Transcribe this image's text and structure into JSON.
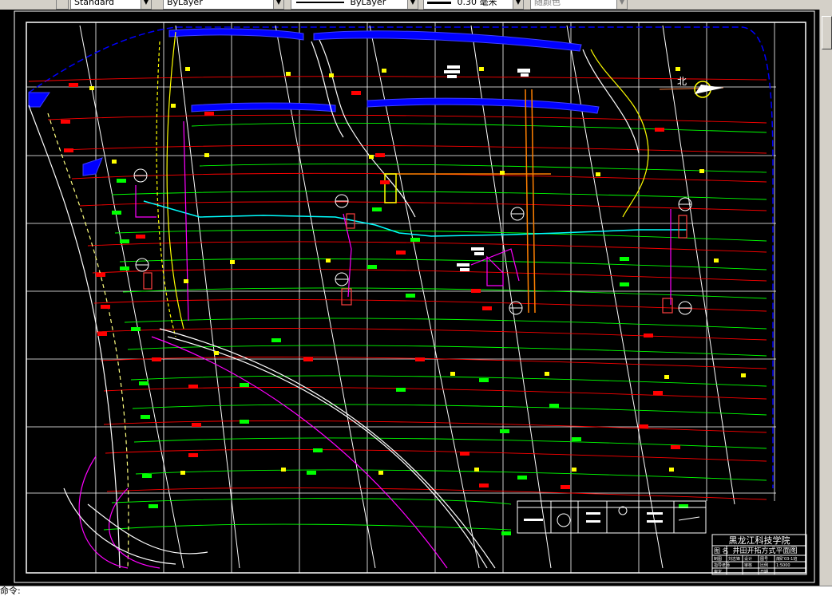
{
  "toolbar": {
    "text_style": "Standard",
    "layer_dropdown": "ByLayer",
    "linetype_dropdown": "ByLayer",
    "lineweight_dropdown": "0.30 毫米",
    "plot_style_dropdown": "随颜色"
  },
  "drawing": {
    "north_label": "北",
    "title_block": {
      "school": "黑龙江科技学院",
      "drawing_name_label": "图  名",
      "drawing_name": "井田开拓方式平面图",
      "row1": [
        "制图",
        "刘志锋",
        "设计",
        "图号",
        "煤矿03-1班"
      ],
      "row2": [
        "指导老师",
        "",
        "审核",
        "比例",
        "1:5000"
      ],
      "row3": [
        "审定",
        "",
        "",
        "日期",
        ""
      ]
    },
    "colors": {
      "background": "#000000",
      "contour_red": "#ff0000",
      "contour_green": "#00ff00",
      "grid_white": "#ffffff",
      "river_blue": "#0000ff",
      "magenta": "#ff00ff",
      "yellow": "#ffff00",
      "cyan": "#00ffff",
      "orange": "#ff8000"
    }
  },
  "command_line": {
    "prompt": "命令:"
  }
}
